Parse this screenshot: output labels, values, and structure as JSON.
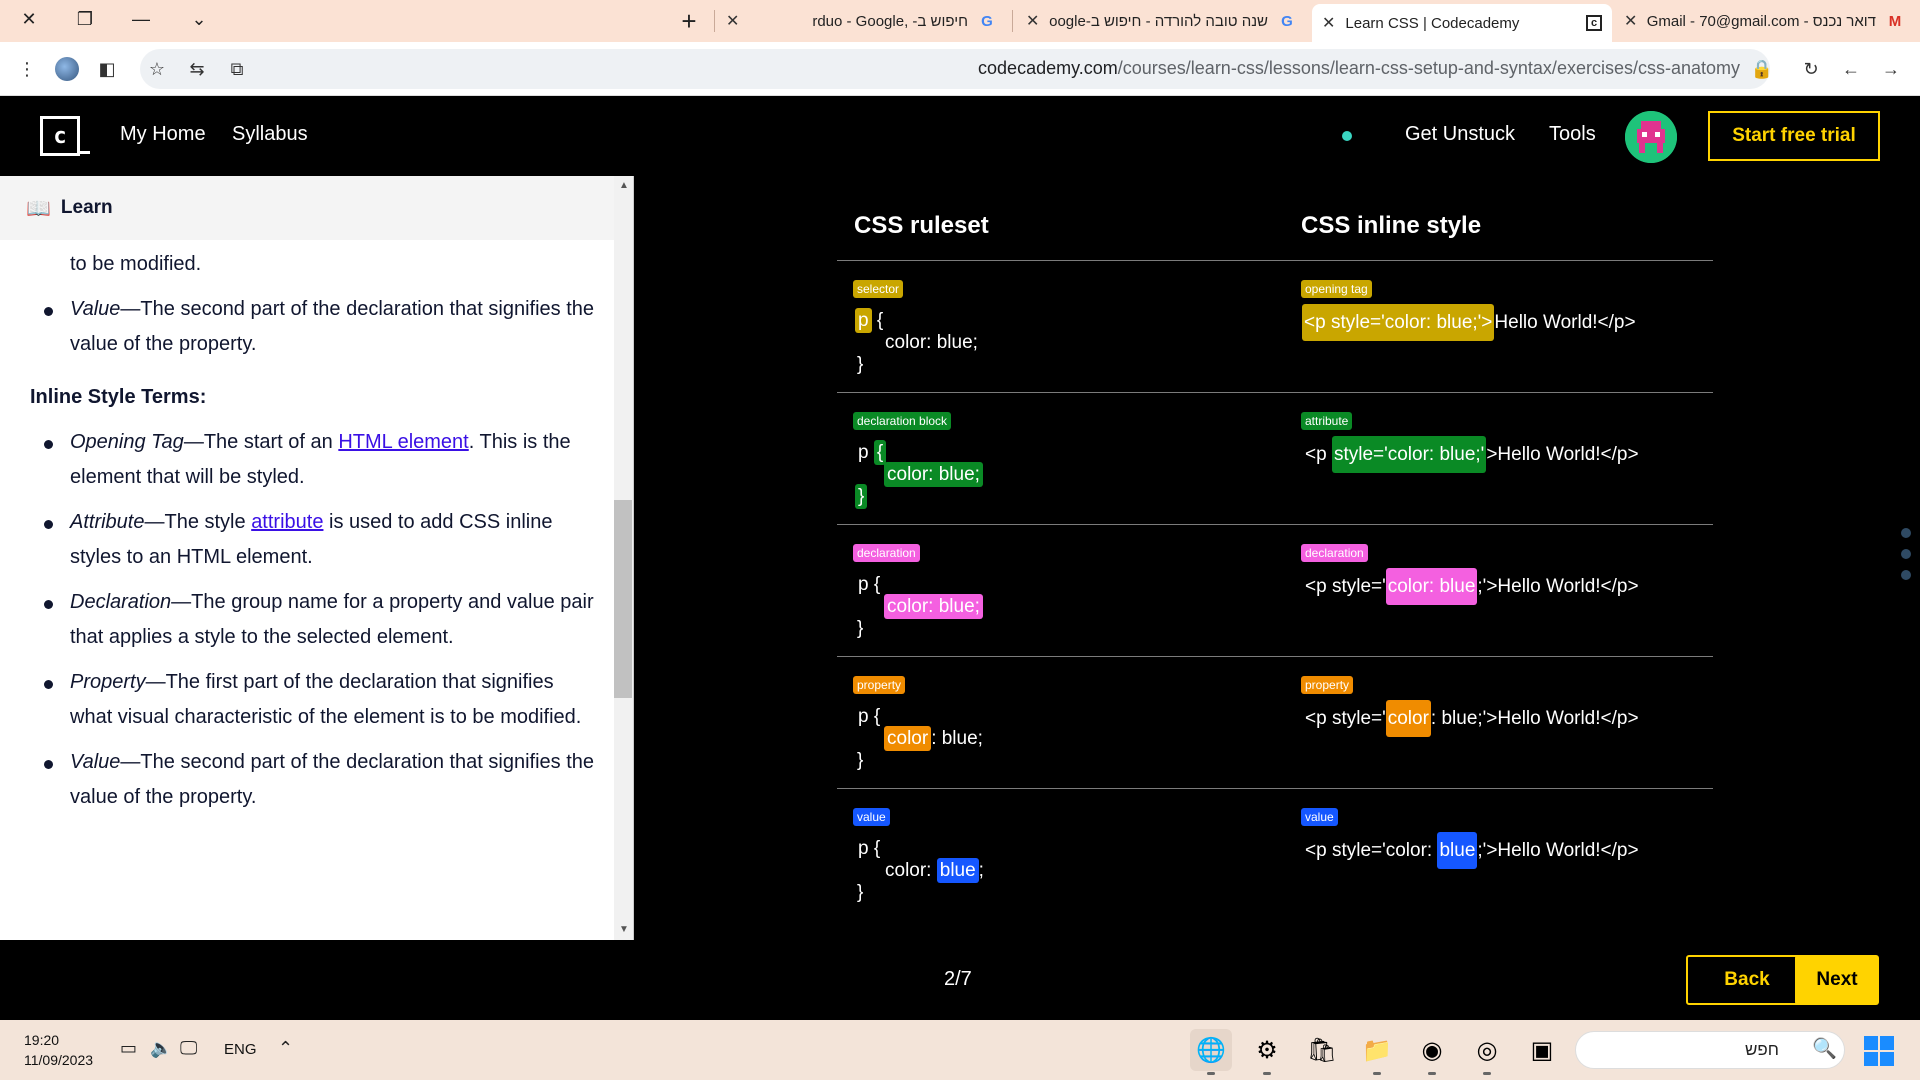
{
  "browser": {
    "tabs": [
      {
        "title": "חיפוש ב- ,rduo - Google",
        "favicon": "google-icon"
      },
      {
        "title": "שנה טובה להורדה - חיפוש ב-Google",
        "favicon": "google-icon"
      },
      {
        "title": "Learn CSS | Codecademy",
        "favicon": "codecademy-icon",
        "active": true
      },
      {
        "title": "דואר נכנס - Gmail - 70@gmail.com",
        "favicon": "gmail-icon"
      }
    ],
    "url_domain": "codecademy.com",
    "url_path": "/courses/learn-css/lessons/learn-css-setup-and-syntax/exercises/css-anatomy"
  },
  "header": {
    "logo_text": "c",
    "nav": [
      "My Home",
      "Syllabus"
    ],
    "get_unstuck": "Get Unstuck",
    "tools": "Tools",
    "trial_button": "Start free trial"
  },
  "left": {
    "panel_title": "Learn",
    "top_cut": "signifies what visual characteristic of the element is",
    "top_cont": "to be modified.",
    "item_value_1": {
      "term": "Value",
      "text": "—The second part of the declaration that signifies the value of the property."
    },
    "inline_heading": "Inline Style Terms:",
    "item_opening": {
      "term": "Opening Tag",
      "text1": "—The start of an ",
      "link": "HTML element",
      "text2": ". This is the element that will be styled."
    },
    "item_attribute": {
      "term": "Attribute",
      "text1": "—The style ",
      "link": "attribute",
      "text2": " is used to add CSS inline styles to an HTML element."
    },
    "item_declaration": {
      "term": "Declaration",
      "text": "—The group name for a property and value pair that applies a style to the selected element."
    },
    "item_property": {
      "term": "Property",
      "text": "—The first part of the declaration that signifies what visual characteristic of the element is to be modified."
    },
    "item_value_2": {
      "term": "Value",
      "text": "—The second part of the declaration that signifies the value of the property."
    }
  },
  "diagram": {
    "col_ruleset": "CSS ruleset",
    "col_inline": "CSS inline style",
    "rows": [
      {
        "left_badge": "selector",
        "right_badge": "opening tag",
        "color": "#c9a600"
      },
      {
        "left_badge": "declaration block",
        "right_badge": "attribute",
        "color": "#0a8a25"
      },
      {
        "left_badge": "declaration",
        "right_badge": "declaration",
        "color": "#f460e0"
      },
      {
        "left_badge": "property",
        "right_badge": "property",
        "color": "#f08c00"
      },
      {
        "left_badge": "value",
        "right_badge": "value",
        "color": "#1557ff"
      }
    ],
    "code": {
      "p": "p",
      "brace_open": "{",
      "brace_close": "}",
      "decl": "color: blue;",
      "prop": "color",
      "colon_val": ": blue;",
      "val": "blue",
      "prop_colon": "color: ",
      "semi": ";",
      "inline_full_open": "<p style='color: blue;'>",
      "inline_tail": "Hello World!</p>",
      "inline_p": "<p ",
      "inline_attr": "style='color: blue;'",
      "inline_close": ">Hello World!</p>",
      "inline_style_q": "<p style='",
      "inline_decl": "color: blue",
      "inline_semi_close": ";'>Hello World!</p>",
      "inline_rest_val": ": blue;'>Hello World!</p>",
      "inline_prefix_val": "<p style='color: ",
      "inline_semi_tail": ";'>Hello World!</p>"
    }
  },
  "footer": {
    "progress": "2/7",
    "back": "Back",
    "next": "Next"
  },
  "taskbar": {
    "time": "19:20",
    "date": "11/09/2023",
    "lang": "ENG",
    "search_placeholder": "חפש"
  }
}
